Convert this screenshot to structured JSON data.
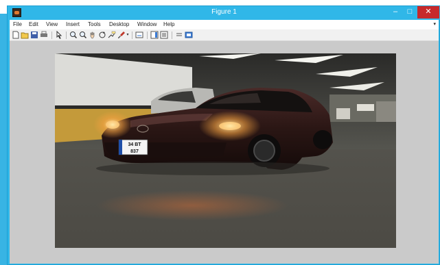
{
  "window": {
    "title": "Figure 1"
  },
  "window_controls": {
    "minimize": "–",
    "maximize": "□",
    "close": "✕"
  },
  "menu": {
    "items": [
      "File",
      "Edit",
      "View",
      "Insert",
      "Tools",
      "Desktop",
      "Window",
      "Help"
    ],
    "overflow_arrow": "▾"
  },
  "toolbar": {
    "icons": [
      "new-figure-icon",
      "open-file-icon",
      "save-icon",
      "print-icon",
      "edit-plot-icon",
      "zoom-in-icon",
      "zoom-out-icon",
      "pan-icon",
      "rotate-3d-icon",
      "data-cursor-icon",
      "brush-icon",
      "link-plot-icon",
      "colorbar-icon",
      "legend-icon",
      "hide-plot-tools-icon",
      "show-plot-tools-icon"
    ]
  },
  "figure": {
    "content": "car-photo",
    "license_plate": {
      "line1": "34 BT",
      "line2": "837"
    }
  },
  "colors": {
    "titlebar": "#30b7e8",
    "close_button": "#c7292b",
    "figure_background": "#cacaca"
  }
}
